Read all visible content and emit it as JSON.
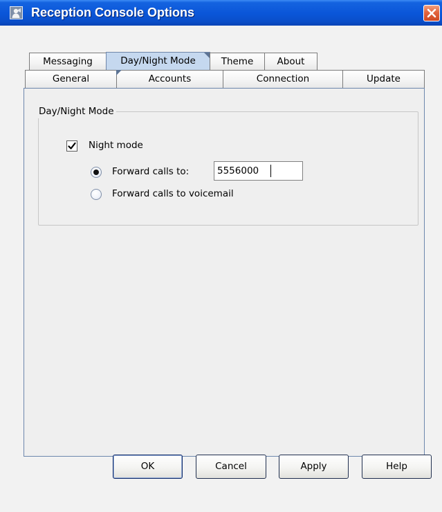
{
  "window": {
    "title": "Reception Console Options",
    "icon": "app-icon",
    "close_icon": "close-icon"
  },
  "tabs": {
    "top_row": [
      {
        "label": "Messaging",
        "selected": false
      },
      {
        "label": "Day/Night Mode",
        "selected": true
      },
      {
        "label": "Theme",
        "selected": false
      },
      {
        "label": "About",
        "selected": false
      }
    ],
    "bottom_row": [
      {
        "label": "General",
        "selected": false
      },
      {
        "label": "Accounts",
        "selected": false
      },
      {
        "label": "Connection",
        "selected": false
      },
      {
        "label": "Update",
        "selected": false
      }
    ]
  },
  "day_night": {
    "group_title": "Day/Night Mode",
    "night_mode_label": "Night mode",
    "night_mode_checked": true,
    "forward_calls_label": "Forward calls to:",
    "forward_calls_selected": true,
    "forward_number": "5556000",
    "forward_voicemail_label": "Forward calls to voicemail",
    "forward_voicemail_selected": false
  },
  "buttons": {
    "ok": "OK",
    "cancel": "Cancel",
    "apply": "Apply",
    "help": "Help"
  },
  "colors": {
    "titlebar": "#0a55d8",
    "selected_tab": "#c5d8ef",
    "close_button": "#e2643d",
    "panel_border": "#6c86ac"
  }
}
